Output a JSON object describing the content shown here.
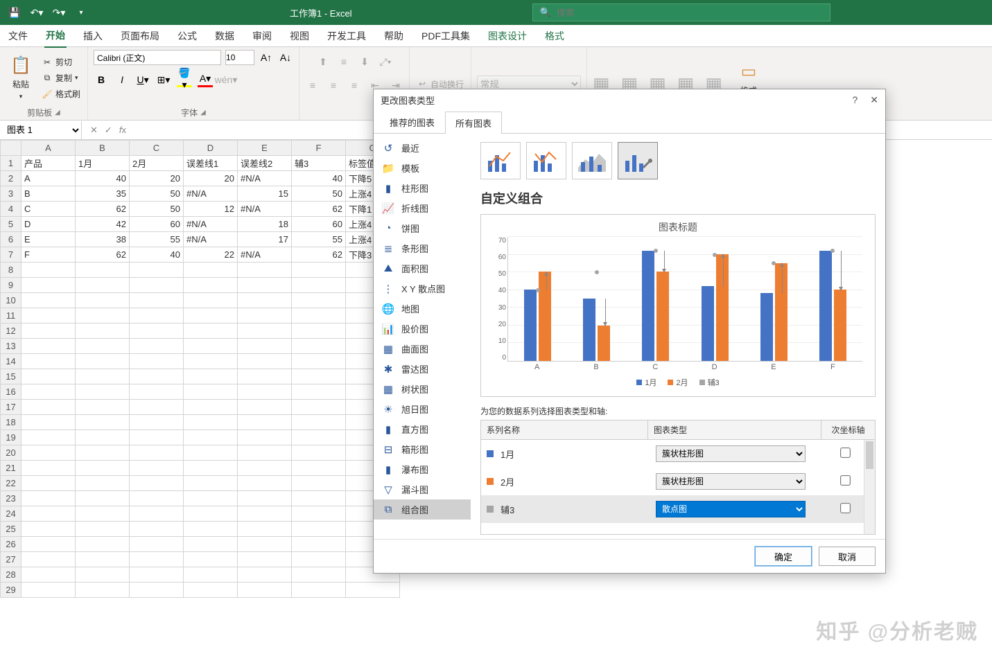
{
  "title": "工作簿1 - Excel",
  "search_placeholder": "搜索",
  "tabs": [
    "文件",
    "开始",
    "插入",
    "页面布局",
    "公式",
    "数据",
    "审阅",
    "视图",
    "开发工具",
    "帮助",
    "PDF工具集",
    "图表设计",
    "格式"
  ],
  "active_tab": "开始",
  "ribbon": {
    "clipboard": {
      "paste": "粘贴",
      "cut": "剪切",
      "copy": "复制",
      "brush": "格式刷",
      "label": "剪贴板"
    },
    "font": {
      "name": "Calibri (正文)",
      "size": "10",
      "label": "字体"
    },
    "alignment": {
      "wrap": "自动换行"
    },
    "number": {
      "format": "常规"
    },
    "format_btn": "格式"
  },
  "name_box": "图表 1",
  "sheet": {
    "cols": [
      "A",
      "B",
      "C",
      "D",
      "E",
      "F",
      "G"
    ],
    "headers": [
      "产品",
      "1月",
      "2月",
      "误差线1",
      "误差线2",
      "辅3",
      "标签值"
    ],
    "rows": [
      {
        "r": 1,
        "c": [
          "产品",
          "1月",
          "2月",
          "误差线1",
          "误差线2",
          "辅3",
          "标签值"
        ]
      },
      {
        "r": 2,
        "c": [
          "A",
          "40",
          "20",
          "20",
          "#N/A",
          "40",
          "下降5"
        ]
      },
      {
        "r": 3,
        "c": [
          "B",
          "35",
          "50",
          "#N/A",
          "15",
          "50",
          "上涨4"
        ]
      },
      {
        "r": 4,
        "c": [
          "C",
          "62",
          "50",
          "12",
          "#N/A",
          "62",
          "下降1"
        ]
      },
      {
        "r": 5,
        "c": [
          "D",
          "42",
          "60",
          "#N/A",
          "18",
          "60",
          "上涨4"
        ]
      },
      {
        "r": 6,
        "c": [
          "E",
          "38",
          "55",
          "#N/A",
          "17",
          "55",
          "上涨4"
        ]
      },
      {
        "r": 7,
        "c": [
          "F",
          "62",
          "40",
          "22",
          "#N/A",
          "62",
          "下降3"
        ]
      }
    ]
  },
  "dialog": {
    "title": "更改图表类型",
    "tabs": [
      "推荐的图表",
      "所有图表"
    ],
    "cats": [
      "最近",
      "模板",
      "柱形图",
      "折线图",
      "饼图",
      "条形图",
      "面积图",
      "X Y 散点图",
      "地图",
      "股价图",
      "曲面图",
      "雷达图",
      "树状图",
      "旭日图",
      "直方图",
      "箱形图",
      "瀑布图",
      "漏斗图",
      "组合图"
    ],
    "selected_cat": "组合图",
    "combo_title": "自定义组合",
    "preview_title": "图表标题",
    "series_section_label": "为您的数据系列选择图表类型和轴:",
    "hdr_name": "系列名称",
    "hdr_type": "图表类型",
    "hdr_axis": "次坐标轴",
    "series": [
      {
        "name": "1月",
        "type": "簇状柱形图",
        "color": "#4472c4",
        "axis": false
      },
      {
        "name": "2月",
        "type": "簇状柱形图",
        "color": "#ed7d31",
        "axis": false
      },
      {
        "name": "辅3",
        "type": "散点图",
        "color": "#a5a5a5",
        "axis": false,
        "selected": true
      }
    ],
    "ok": "确定",
    "cancel": "取消",
    "help": "?"
  },
  "chart_data": {
    "type": "bar",
    "title": "图表标题",
    "categories": [
      "A",
      "B",
      "C",
      "D",
      "E",
      "F"
    ],
    "series": [
      {
        "name": "1月",
        "values": [
          40,
          35,
          62,
          42,
          38,
          62
        ],
        "color": "#4472c4"
      },
      {
        "name": "2月",
        "values": [
          50,
          20,
          50,
          60,
          55,
          40
        ],
        "color": "#ed7d31"
      },
      {
        "name": "辅3",
        "values": [
          40,
          50,
          62,
          60,
          55,
          62
        ],
        "color": "#a5a5a5",
        "type": "scatter"
      }
    ],
    "ylim": [
      0,
      70
    ],
    "yticks": [
      0,
      10,
      20,
      30,
      40,
      50,
      60,
      70
    ],
    "xlabel": "",
    "ylabel": ""
  },
  "watermark": "知乎 @分析老贼"
}
